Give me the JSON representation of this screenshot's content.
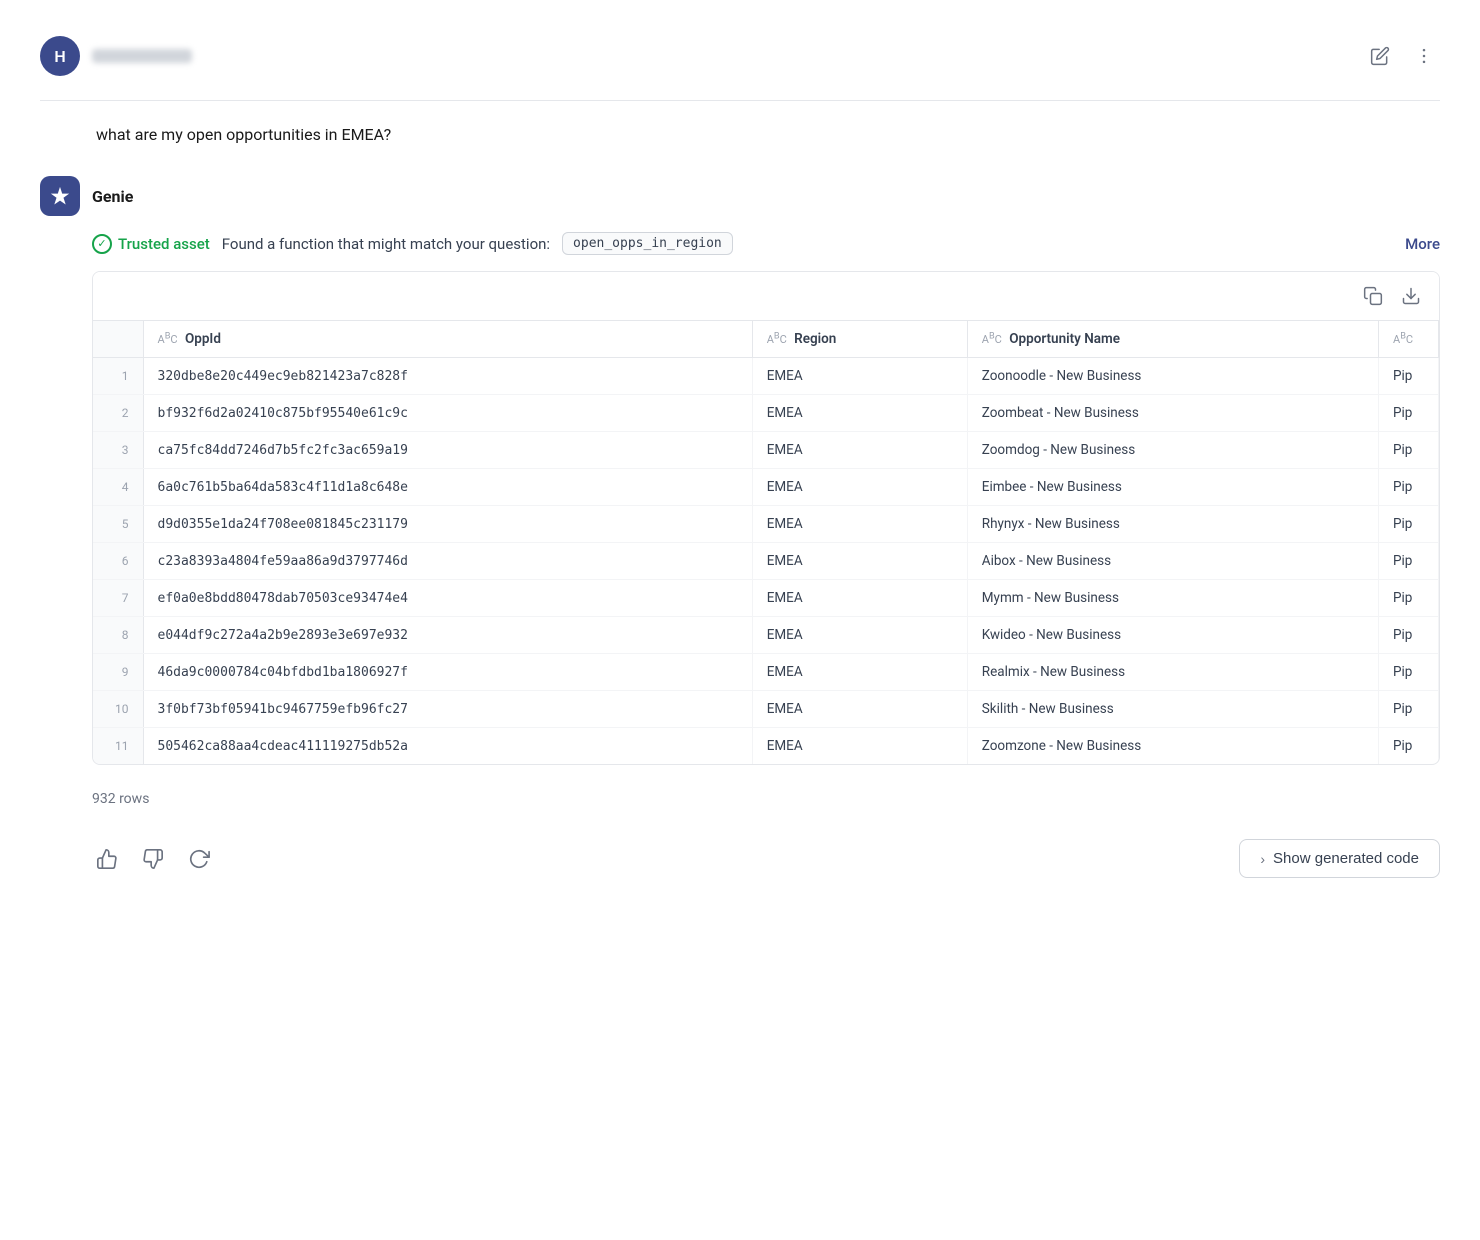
{
  "header": {
    "avatar_letter": "H",
    "edit_label": "edit",
    "more_label": "more options"
  },
  "user_message": {
    "text": "what are my open opportunities in EMEA?"
  },
  "genie": {
    "name": "Genie",
    "trusted_asset_label": "Trusted asset",
    "found_text": "Found a function that might match your question:",
    "function_name": "open_opps_in_region",
    "more_label": "More"
  },
  "table": {
    "copy_label": "Copy",
    "download_label": "Download",
    "columns": [
      {
        "id": "row_num",
        "label": "",
        "type": ""
      },
      {
        "id": "opp_id",
        "label": "OppId",
        "type": "ABC"
      },
      {
        "id": "region",
        "label": "Region",
        "type": "ABC"
      },
      {
        "id": "opportunity_name",
        "label": "Opportunity Name",
        "type": "ABC"
      },
      {
        "id": "extra",
        "label": "",
        "type": "ABC"
      }
    ],
    "rows": [
      {
        "num": 1,
        "opp_id": "320dbe8e20c449ec9eb821423a7c828f",
        "region": "EMEA",
        "opportunity_name": "Zoonoodle - New Business",
        "extra": "Pip"
      },
      {
        "num": 2,
        "opp_id": "bf932f6d2a02410c875bf95540e61c9c",
        "region": "EMEA",
        "opportunity_name": "Zoombeat - New Business",
        "extra": "Pip"
      },
      {
        "num": 3,
        "opp_id": "ca75fc84dd7246d7b5fc2fc3ac659a19",
        "region": "EMEA",
        "opportunity_name": "Zoomdog - New Business",
        "extra": "Pip"
      },
      {
        "num": 4,
        "opp_id": "6a0c761b5ba64da583c4f11d1a8c648e",
        "region": "EMEA",
        "opportunity_name": "Eimbee - New Business",
        "extra": "Pip"
      },
      {
        "num": 5,
        "opp_id": "d9d0355e1da24f708ee081845c231179",
        "region": "EMEA",
        "opportunity_name": "Rhynyx - New Business",
        "extra": "Pip"
      },
      {
        "num": 6,
        "opp_id": "c23a8393a4804fe59aa86a9d3797746d",
        "region": "EMEA",
        "opportunity_name": "Aibox - New Business",
        "extra": "Pip"
      },
      {
        "num": 7,
        "opp_id": "ef0a0e8bdd80478dab70503ce93474e4",
        "region": "EMEA",
        "opportunity_name": "Mymm - New Business",
        "extra": "Pip"
      },
      {
        "num": 8,
        "opp_id": "e044df9c272a4a2b9e2893e3e697e932",
        "region": "EMEA",
        "opportunity_name": "Kwideo - New Business",
        "extra": "Pip"
      },
      {
        "num": 9,
        "opp_id": "46da9c0000784c04bfdbd1ba1806927f",
        "region": "EMEA",
        "opportunity_name": "Realmix - New Business",
        "extra": "Pip"
      },
      {
        "num": 10,
        "opp_id": "3f0bf73bf05941bc9467759efb96fc27",
        "region": "EMEA",
        "opportunity_name": "Skilith - New Business",
        "extra": "Pip"
      },
      {
        "num": 11,
        "opp_id": "505462ca88aa4cdeac411119275db52a",
        "region": "EMEA",
        "opportunity_name": "Zoomzone - New Business",
        "extra": "Pip"
      }
    ],
    "row_count": "932 rows"
  },
  "bottom_actions": {
    "thumbs_up_label": "thumbs up",
    "thumbs_down_label": "thumbs down",
    "refresh_label": "refresh",
    "show_code_label": "Show generated code"
  }
}
